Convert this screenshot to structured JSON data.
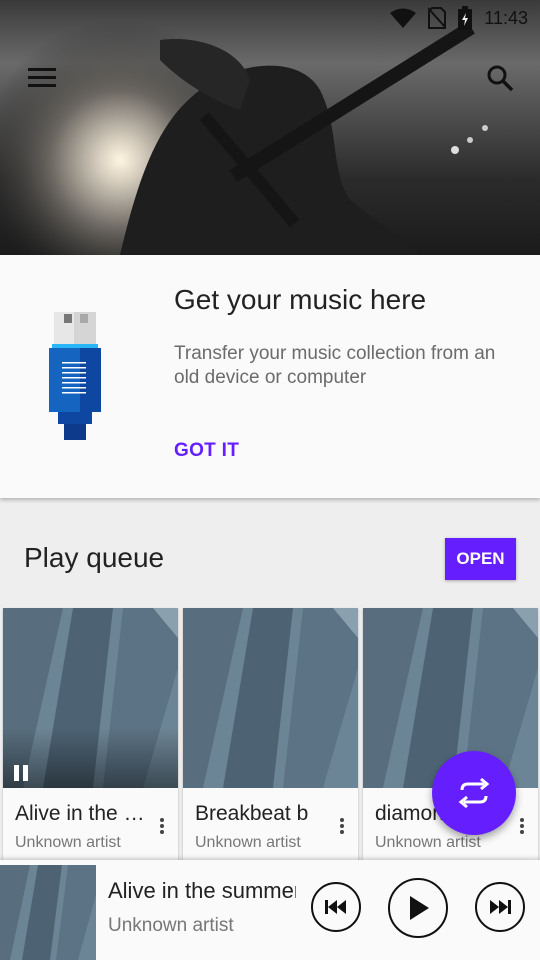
{
  "status": {
    "time": "11:43"
  },
  "card": {
    "title": "Get your music here",
    "description": "Transfer your music collection from an old device or computer",
    "cta": "GOT IT"
  },
  "queue": {
    "title": "Play queue",
    "open_label": "OPEN",
    "items": [
      {
        "title": "Alive in the summer",
        "artist": "Unknown artist"
      },
      {
        "title": "Breakbeat b",
        "artist": "Unknown artist"
      },
      {
        "title": "diamond",
        "artist": "Unknown artist"
      }
    ]
  },
  "player": {
    "title": "Alive in the summer",
    "artist": "Unknown artist"
  },
  "colors": {
    "accent": "#651fff",
    "text": "#222222",
    "muted": "#777777"
  },
  "icons": [
    "menu-icon",
    "search-icon",
    "wifi-icon",
    "no-sim-icon",
    "battery-icon",
    "usb-icon",
    "pause-icon",
    "more-vert-icon",
    "shuffle-icon",
    "previous-icon",
    "play-icon",
    "next-icon"
  ]
}
